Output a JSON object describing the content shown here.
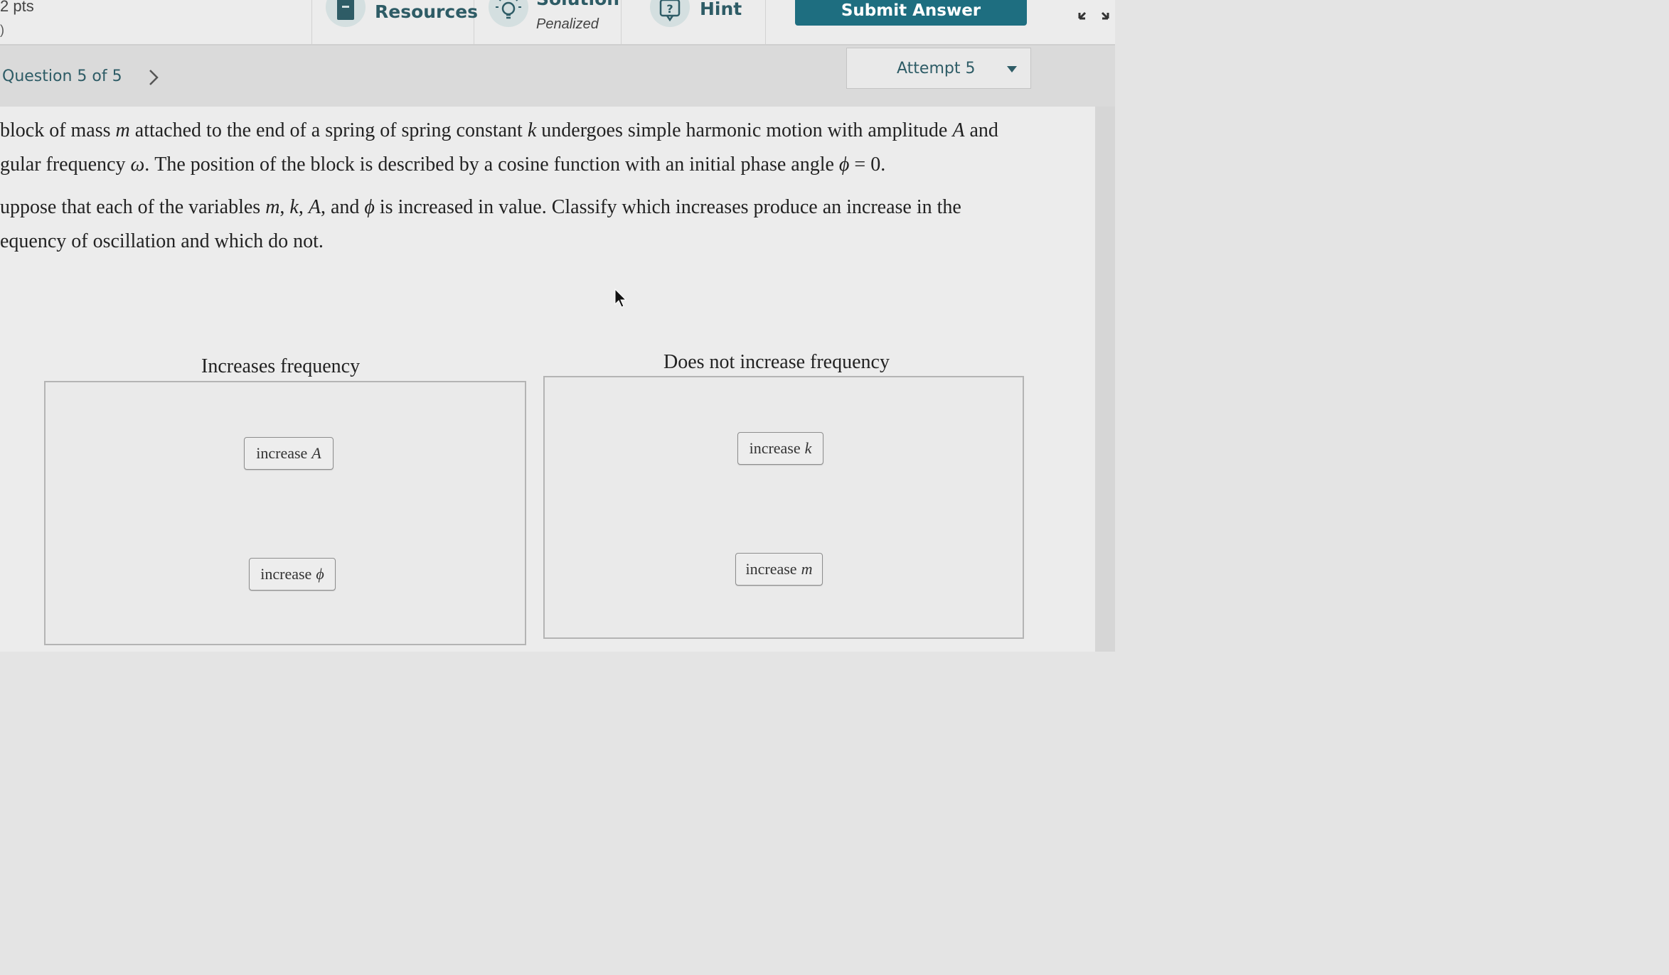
{
  "toolbar": {
    "points_label": "2 pts",
    "points_sub": ")",
    "resources_label": "Resources",
    "solution_label": "Solution",
    "solution_sub": "Penalized",
    "hint_label": "Hint",
    "submit_label": "Submit Answer"
  },
  "question": {
    "number_label": "Question 5 of 5",
    "attempt_label": "Attempt 5"
  },
  "problem": {
    "line1": {
      "t1": "block of mass ",
      "v1": "m",
      "t2": " attached to the end of a spring of spring constant ",
      "v2": "k",
      "t3": " undergoes simple harmonic motion with amplitude ",
      "v3": "A",
      "t4": " and"
    },
    "line2": {
      "t1": "gular frequency ",
      "v1": "ω",
      "t2": ". The position of the block is described by a cosine function with an initial phase angle ",
      "v2": "ϕ",
      "t3": " = 0."
    },
    "line3": {
      "t1": "uppose that each of the variables ",
      "v1": "m",
      "t2": ", ",
      "v2": "k",
      "t3": ", ",
      "v3": "A",
      "t4": ", and ",
      "v4": "ϕ",
      "t5": " is increased in value. Classify which increases produce an increase in the"
    },
    "line4": "equency of oscillation and which do not."
  },
  "bins": {
    "left": {
      "title": "Increases frequency",
      "items": [
        {
          "prefix": "increase",
          "var": "A"
        },
        {
          "prefix": "increase",
          "var": "ϕ"
        }
      ]
    },
    "right": {
      "title": "Does not increase frequency",
      "items": [
        {
          "prefix": "increase",
          "var": "k"
        },
        {
          "prefix": "increase",
          "var": "m"
        }
      ]
    }
  },
  "icons": {
    "resources": "book-icon",
    "solution": "lightbulb-icon",
    "hint": "question-bubble-icon",
    "expand": "expand-icon",
    "next": "chevron-right-icon",
    "attempt_dropdown": "caret-down-icon"
  },
  "colors": {
    "accent": "#2e5c66",
    "submit_bg": "#1e6e80"
  }
}
